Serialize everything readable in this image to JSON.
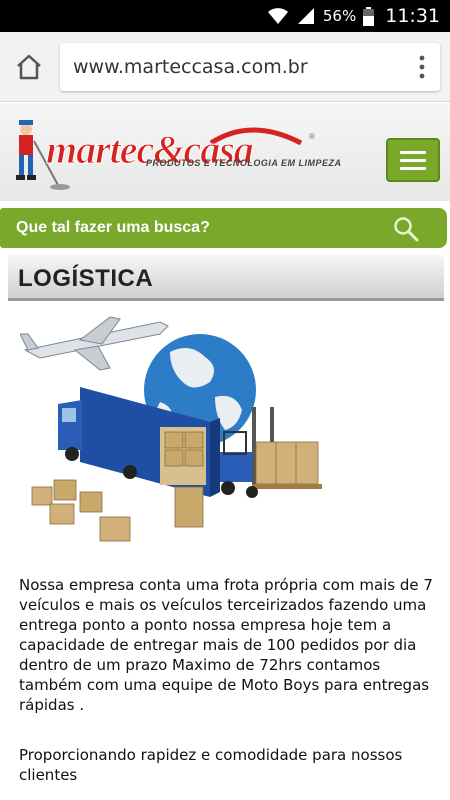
{
  "status_bar": {
    "battery": "56%",
    "time": "11:31",
    "icons": [
      "wifi-icon",
      "signal-icon",
      "battery-icon"
    ]
  },
  "browser": {
    "url": "www.marteccasa.com.br",
    "icons": [
      "home-icon",
      "more-vert-icon"
    ]
  },
  "header": {
    "logo_text_left": "martec",
    "logo_amp": "&",
    "logo_text_right": "casa",
    "logo_tagline": "PRODUTOS E TECNOLOGIA EM LIMPEZA",
    "menu_icon": "hamburger-icon"
  },
  "search": {
    "label": "Que tal fazer uma busca?",
    "icon": "search-icon"
  },
  "page": {
    "title": "LOGÍSTICA",
    "paragraph1": "Nossa empresa conta uma frota própria com mais de 7 veículos e mais os veículos terceirizados fazendo uma entrega ponto a ponto nossa empresa hoje tem a capacidade de entregar mais de 100 pedidos por dia dentro de um prazo Maximo de 72hrs contamos também com uma equipe de Moto Boys para entregas rápidas .",
    "paragraph2": "Proporcionando rapidez e comodidade para nossos clientes"
  },
  "colors": {
    "brand_green": "#7aa82b",
    "brand_red": "#d7231f"
  }
}
